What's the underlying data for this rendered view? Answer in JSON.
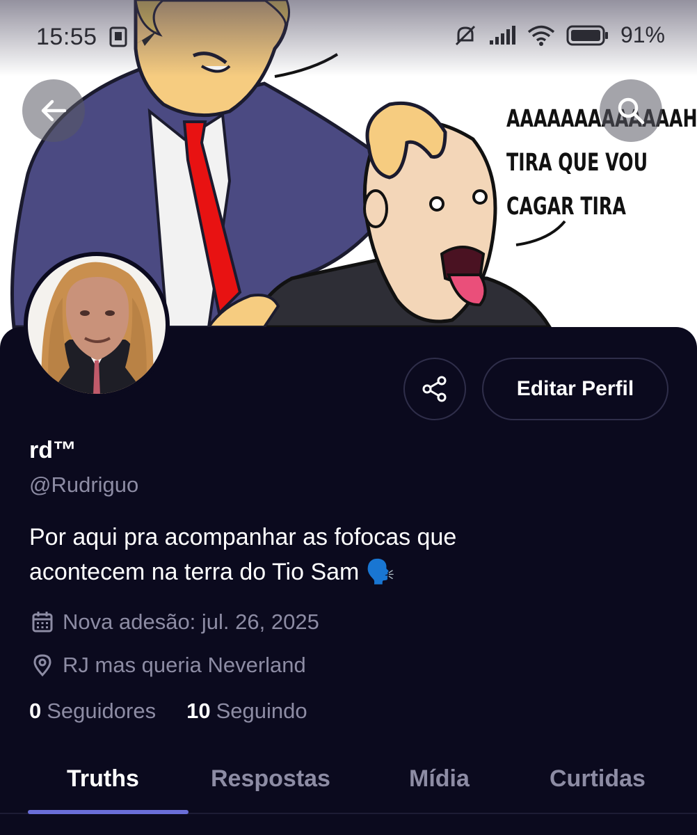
{
  "status_bar": {
    "time": "15:55",
    "battery": "91%",
    "icons": [
      "screen-record-icon",
      "send-icon",
      "mute-icon",
      "signal-icon",
      "wifi-icon",
      "battery-icon"
    ]
  },
  "banner": {
    "meme_text": [
      "AAAAAAAAAAAAAH",
      "TIRA QUE VOU",
      "CAGAR TIRA"
    ]
  },
  "header": {
    "back_icon": "arrow-left-icon",
    "search_icon": "search-icon"
  },
  "profile": {
    "display_name": "rd™",
    "handle": "@Rudriguo",
    "bio_line1": "Por aqui pra acompanhar as fofocas que",
    "bio_line2": "acontecem na terra do Tio Sam 🗣️",
    "joined": "Nova adesão: jul. 26, 2025",
    "location": "RJ mas queria Neverland",
    "followers_count": "0",
    "followers_label": "Seguidores",
    "following_count": "10",
    "following_label": "Seguindo"
  },
  "actions": {
    "share_icon": "share-icon",
    "edit_label": "Editar Perfil"
  },
  "tabs": [
    {
      "label": "Truths",
      "active": true
    },
    {
      "label": "Respostas",
      "active": false
    },
    {
      "label": "Mídia",
      "active": false
    },
    {
      "label": "Curtidas",
      "active": false
    }
  ],
  "colors": {
    "background": "#0b0a1e",
    "muted_text": "#8d8ca4",
    "accent": "#6a6ed8",
    "border": "#2f2e4a"
  }
}
